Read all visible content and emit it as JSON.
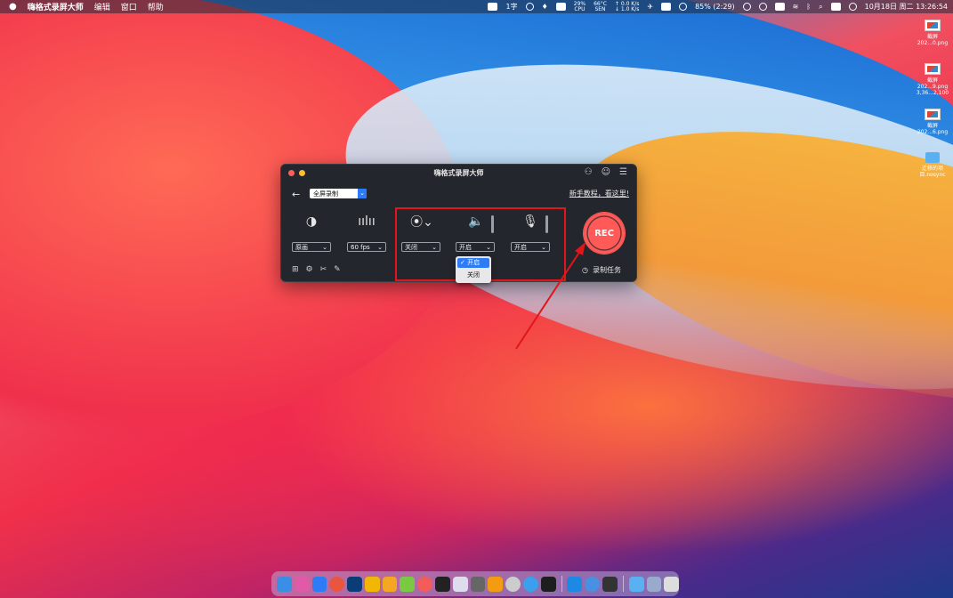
{
  "menubar": {
    "apple": "",
    "app_name": "嗨格式录屏大师",
    "menus": [
      "编辑",
      "窗口",
      "帮助"
    ],
    "status": {
      "input_method": "1字",
      "cpu_percent": "29%",
      "cpu_label": "CPU",
      "temp": "66°C",
      "temp_label": "SEN",
      "net_up": "↑ 0.0 K/s",
      "net_down": "↓ 1.0 K/s",
      "battery": "85% (2:29)",
      "datetime": "10月18日 周二  13:26:54"
    }
  },
  "desktop_icons": [
    {
      "label": "截屏",
      "sub": "202...0.png"
    },
    {
      "label": "截屏",
      "sub": "202...9.png",
      "extra": "3,36...2,100"
    },
    {
      "label": "截屏",
      "sub": "202...6.png"
    },
    {
      "label": "迁移的项",
      "sub": "目.nosync"
    }
  ],
  "window": {
    "title": "嗨格式录屏大师",
    "mode_select": "全屏录制",
    "tutorial_link": "新手教程，看这里!",
    "controls": {
      "quality": "原画",
      "fps": "60 fps",
      "camera": "关闭",
      "system_audio": "开启",
      "microphone": "开启"
    },
    "dropdown_options": {
      "selected": "✓ 开启",
      "other": "关闭"
    },
    "rec_label": "REC",
    "task_label": "录制任务"
  },
  "colors": {
    "accent": "#2d7cf6",
    "rec": "#ff5a57",
    "highlight": "#e0161a",
    "window_bg": "#24262d"
  }
}
